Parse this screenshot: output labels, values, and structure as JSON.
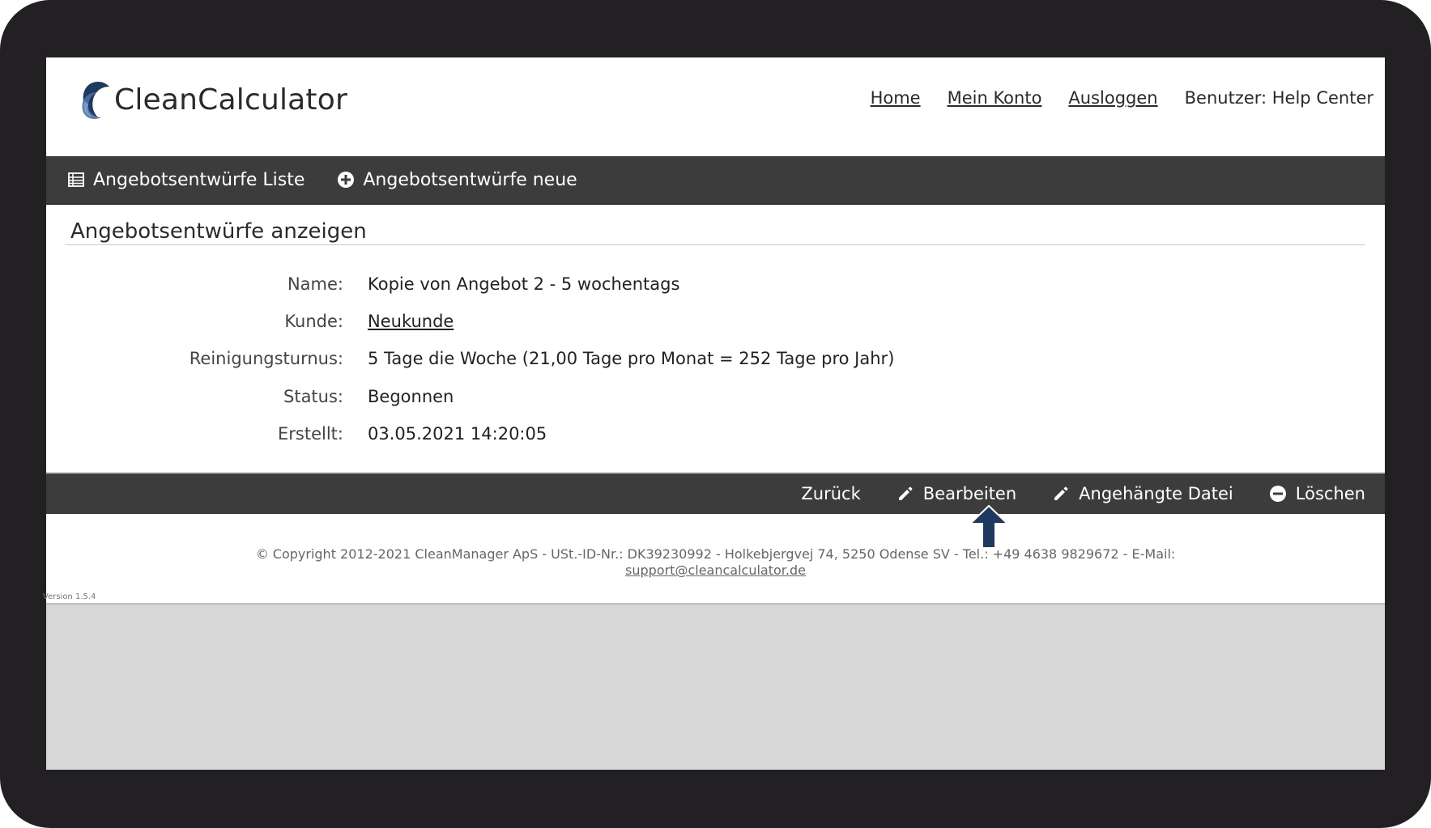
{
  "app": {
    "logo_text": "CleanCalculator"
  },
  "topnav": {
    "home": "Home",
    "account": "Mein Konto",
    "logout": "Ausloggen",
    "user": "Benutzer: Help Center"
  },
  "toolbar": {
    "list_label": "Angebotsentwürfe Liste",
    "new_label": "Angebotsentwürfe neue"
  },
  "section": {
    "title": "Angebotsentwürfe anzeigen"
  },
  "details": [
    {
      "label": "Name:",
      "value": "Kopie von Angebot 2 - 5 wochentags"
    },
    {
      "label": "Kunde:",
      "value": "Neukunde"
    },
    {
      "label": "Reinigungsturnus:",
      "value": "5 Tage die Woche (21,00 Tage pro Monat = 252 Tage pro Jahr)"
    },
    {
      "label": "Status:",
      "value": "Begonnen"
    },
    {
      "label": "Erstellt:",
      "value": "03.05.2021 14:20:05"
    }
  ],
  "actions": {
    "back": "Zurück",
    "edit": "Bearbeiten",
    "attached": "Angehängte Datei",
    "delete": "Löschen"
  },
  "footer": {
    "copyright": "© Copyright 2012-2021 CleanManager ApS - USt.-ID-Nr.: DK39230992 - Holkebjergvej 74, 5250 Odense SV - Tel.: +49 4638 9829672 - E-Mail:",
    "email": "support@cleancalculator.de",
    "version": "Version 1.5.4"
  },
  "colors": {
    "frame": "#222022",
    "bar": "#3c3c3c",
    "arrow": "#1f3a5f",
    "background": "#d7d7d7"
  },
  "icons": {
    "list": "table-list-icon",
    "new": "plus-circle-icon",
    "edit": "pencil-icon",
    "attached": "pencil-icon",
    "delete": "minus-circle-icon",
    "pointer": "up-arrow-icon"
  }
}
